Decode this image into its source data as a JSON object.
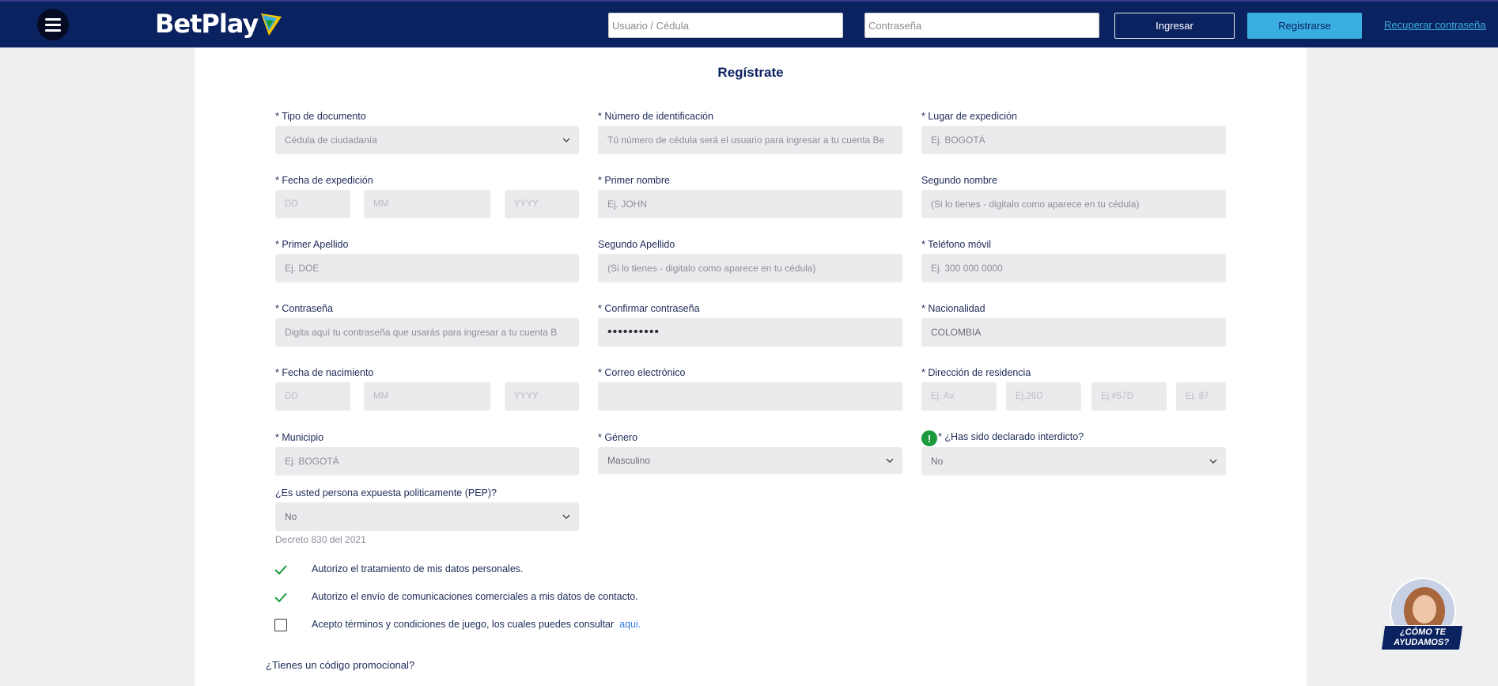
{
  "header": {
    "username_placeholder": "Usuario / Cédula",
    "password_placeholder": "Contraseña",
    "login_label": "Ingresar",
    "register_label": "Registrarse",
    "recover_label": "Recuperar contraseña",
    "logo_text": "BetPlay"
  },
  "form": {
    "title": "Regístrate",
    "doc_type": {
      "label": "* Tipo de documento",
      "value": "Cédula de ciudadanía"
    },
    "id_number": {
      "label": "* Número de identificación",
      "placeholder": "Tú número de cédula será el usuario para ingresar a tu cuenta Be"
    },
    "issue_place": {
      "label": "* Lugar de expedición",
      "placeholder": "Ej. BOGOTÁ"
    },
    "issue_date": {
      "label": "* Fecha de expedición",
      "day": "DD",
      "month": "MM",
      "year": "YYYY"
    },
    "first_name": {
      "label": "* Primer nombre",
      "placeholder": "Ej. JOHN"
    },
    "second_name": {
      "label": "Segundo nombre",
      "placeholder": "(Si lo tienes - digitalo como aparece en tu cédula)"
    },
    "first_surname": {
      "label": "* Primer Apellido",
      "placeholder": "Ej. DOE"
    },
    "second_surname": {
      "label": "Segundo Apellido",
      "placeholder": "(Si lo tienes - digitalo como aparece en tu cédula)"
    },
    "mobile": {
      "label": "* Teléfono móvil",
      "placeholder": "Ej. 300 000 0000"
    },
    "password": {
      "label": "* Contraseña",
      "placeholder": "Digita aquí tu contraseña que usarás para ingresar a tu cuenta B"
    },
    "confirm_password": {
      "label": "* Confirmar contraseña",
      "value": "••••••••••"
    },
    "nationality": {
      "label": "* Nacionalidad",
      "value": "COLOMBIA"
    },
    "birth_date": {
      "label": "* Fecha de nacimiento",
      "day": "DD",
      "month": "MM",
      "year": "YYYY"
    },
    "email": {
      "label": "* Correo electrónico",
      "value": ""
    },
    "address": {
      "label": "* Dirección de residencia",
      "p1": "Ej. Av.",
      "p2": "Ej.26D",
      "p3": "Ej.#57D",
      "p4": "Ej. 87"
    },
    "municipality": {
      "label": "* Municipio",
      "placeholder": "Ej. BOGOTÁ"
    },
    "gender": {
      "label": "* Género",
      "value": "Masculino"
    },
    "interdict": {
      "label": "* ¿Has sido declarado interdicto?",
      "value": "No",
      "info_icon": "!"
    },
    "pep": {
      "label": "¿Es usted persona expuesta politicamente (PEP)?",
      "value": "No",
      "note": "Decreto 830 del 2021"
    },
    "consents": [
      {
        "text": "Autorizo el tratamiento de mis datos personales.",
        "checked": true
      },
      {
        "text": "Autorizo el envío de comunicaciones comerciales a mis datos de contacto.",
        "checked": true
      },
      {
        "text": "Acepto términos y condiciones de juego, los cuales puedes consultar",
        "link": "aqui.",
        "checked": false
      }
    ],
    "promo_label": "¿Tienes un código promocional?"
  },
  "helper": {
    "caption_line1": "¿CÓMO TE",
    "caption_line2": "AYUDAMOS?"
  },
  "colors": {
    "header_bg": "#0b2260",
    "accent": "#3aaee0",
    "field_bg": "#ebebed",
    "check_green": "#1a9a3a"
  }
}
